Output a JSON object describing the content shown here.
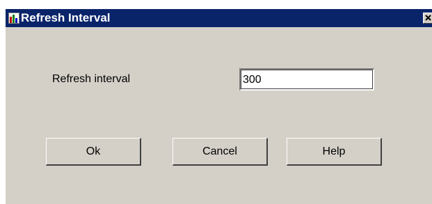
{
  "window": {
    "title": "Refresh Interval",
    "app_icon": "bar-chart-icon",
    "close_icon": "close-icon",
    "colors": {
      "titlebar": "#0a246a",
      "face": "#d4d0c8"
    }
  },
  "form": {
    "interval_label": "Refresh interval",
    "interval_value": "300"
  },
  "buttons": {
    "ok_label": "Ok",
    "cancel_label": "Cancel",
    "help_label": "Help"
  }
}
